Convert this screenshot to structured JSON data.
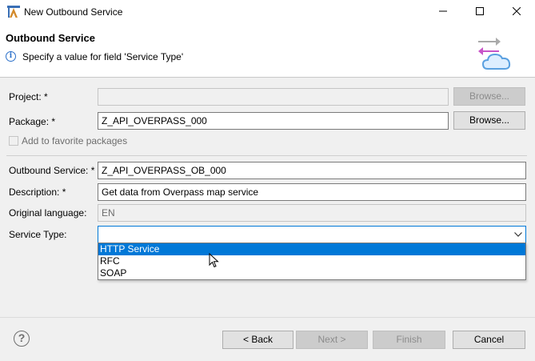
{
  "window": {
    "title": "New Outbound Service",
    "icons": {
      "app": "abap-wizard-icon",
      "minimize": "minimize-icon",
      "maximize": "maximize-icon",
      "close": "close-icon"
    }
  },
  "header": {
    "title": "Outbound Service",
    "message": "Specify a value for field 'Service Type'",
    "message_icon": "info-icon",
    "banner_icon": "outbound-service-cloud-icon"
  },
  "form": {
    "project": {
      "label": "Project: *",
      "value": "",
      "browse": "Browse..."
    },
    "package": {
      "label": "Package: *",
      "value": "Z_API_OVERPASS_000",
      "browse": "Browse..."
    },
    "favorite": {
      "label": "Add to favorite packages",
      "checked": false
    },
    "outbound_service": {
      "label": "Outbound Service: *",
      "value": "Z_API_OVERPASS_OB_000"
    },
    "description": {
      "label": "Description: *",
      "value": "Get data from Overpass map service"
    },
    "original_language": {
      "label": "Original language:",
      "value": "EN"
    },
    "service_type": {
      "label": "Service Type:",
      "value": "",
      "options": [
        "HTTP Service",
        "RFC",
        "SOAP"
      ],
      "highlighted_option": "HTTP Service"
    }
  },
  "footer": {
    "help_icon": "help-icon",
    "back": "< Back",
    "next": "Next >",
    "finish": "Finish",
    "cancel": "Cancel"
  },
  "colors": {
    "selection": "#0078d7",
    "accent_purple": "#c855c8",
    "accent_blue": "#5aa0e0"
  }
}
